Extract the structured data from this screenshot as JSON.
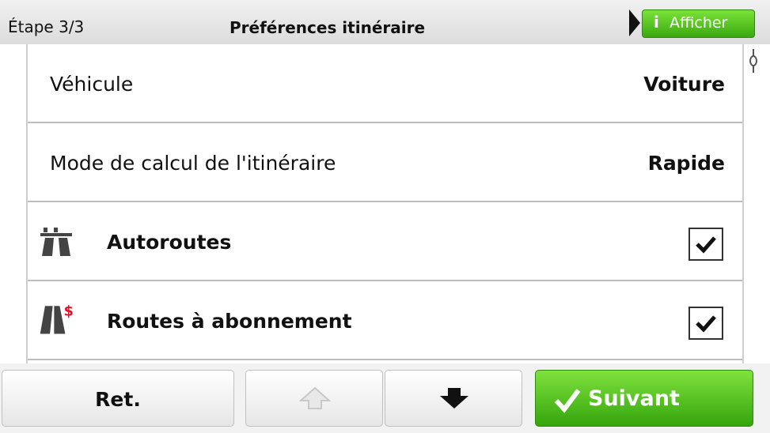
{
  "header": {
    "step": "Étape 3/3",
    "title": "Préférences itinéraire",
    "show_button": {
      "label": "Afficher",
      "icon": "info-icon"
    }
  },
  "rows": [
    {
      "label": "Véhicule",
      "value": "Voiture"
    },
    {
      "label": "Mode de calcul de l'itinéraire",
      "value": "Rapide"
    },
    {
      "label": "Autoroutes",
      "icon": "highway-icon",
      "checked": true
    },
    {
      "label": "Routes à abonnement",
      "icon": "toll-road-icon",
      "checked": true
    }
  ],
  "footer": {
    "back_label": "Ret.",
    "up_icon": "arrow-up-icon",
    "down_icon": "arrow-down-icon",
    "next_label": "Suivant",
    "next_icon": "checkmark-icon"
  },
  "colors": {
    "accent_green": "#3aa910",
    "toll_red": "#e0102a"
  }
}
